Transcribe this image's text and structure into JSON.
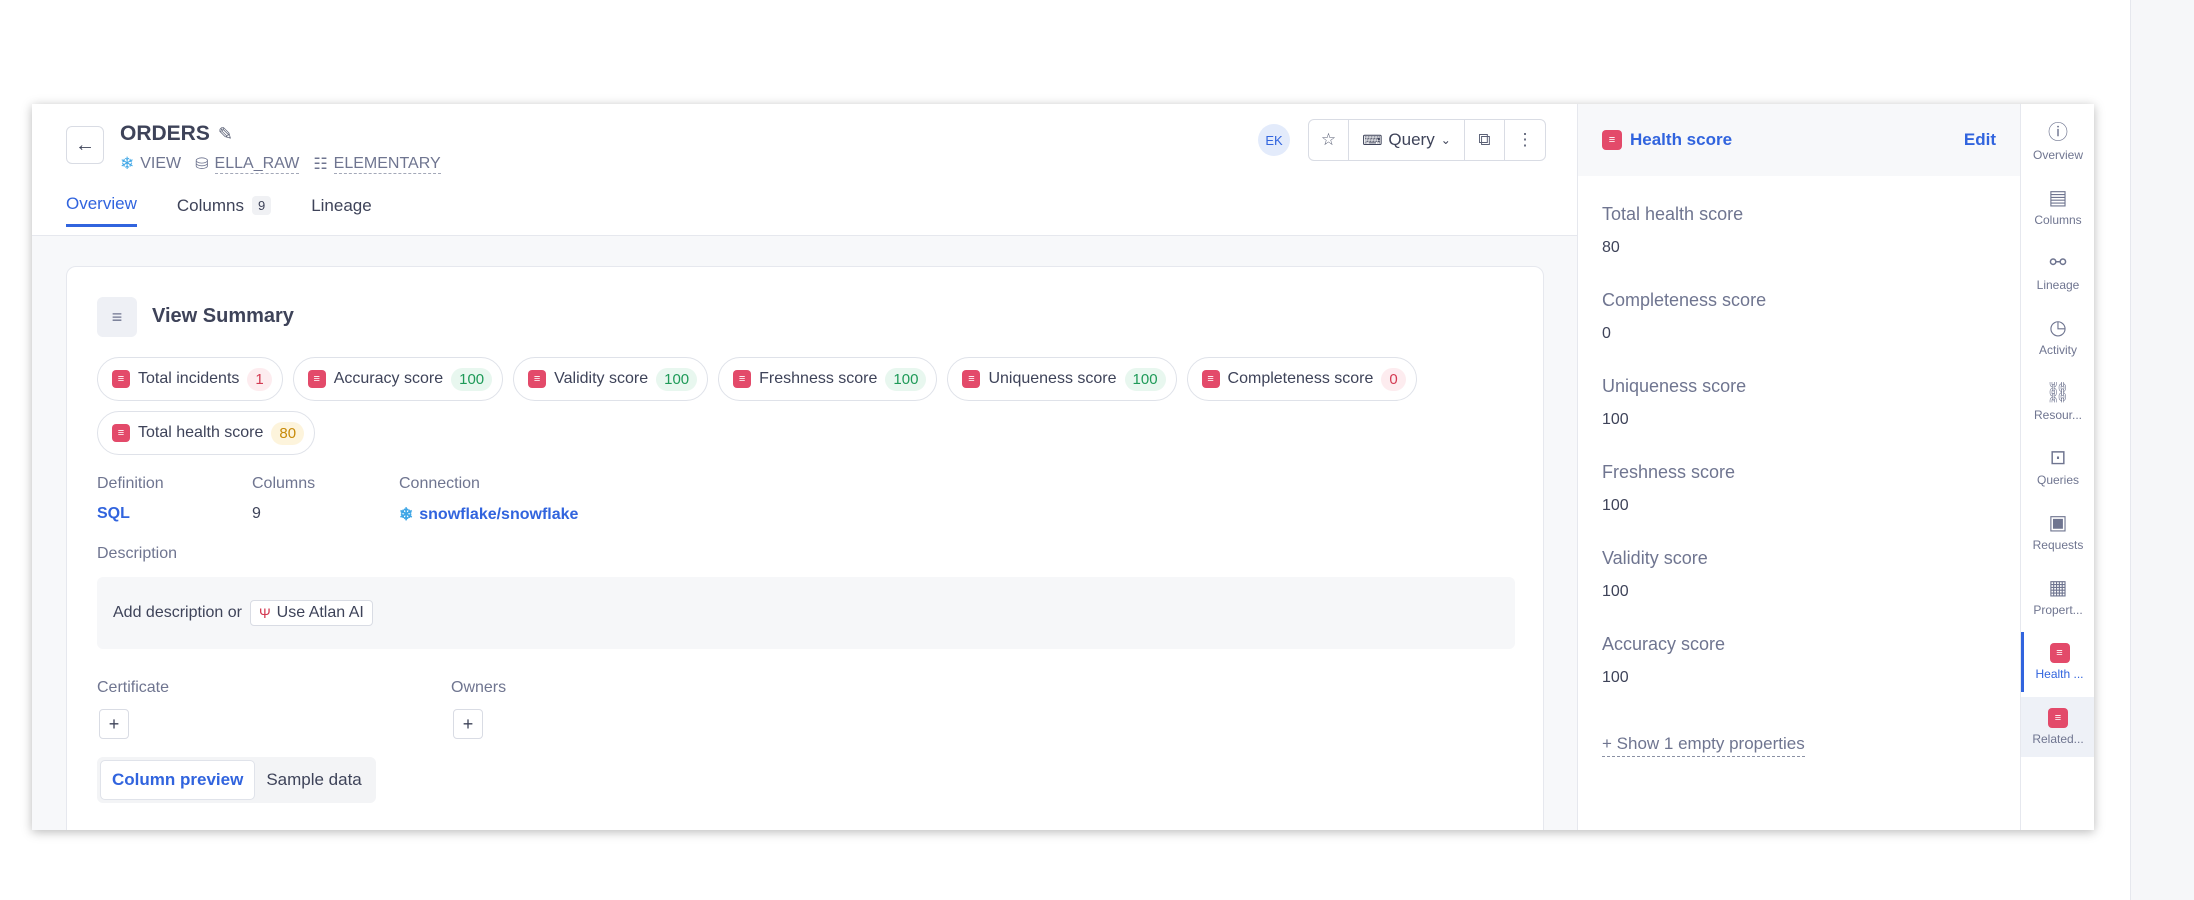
{
  "header": {
    "title": "ORDERS",
    "crumbs": {
      "type": "VIEW",
      "database": "ELLA_RAW",
      "schema": "ELEMENTARY"
    },
    "tabs": [
      {
        "label": "Overview"
      },
      {
        "label": "Columns",
        "count": "9"
      },
      {
        "label": "Lineage"
      }
    ],
    "avatar": "EK",
    "query_label": "Query"
  },
  "summary": {
    "title": "View Summary",
    "chips": [
      {
        "label": "Total incidents",
        "value": "1",
        "tone": "red"
      },
      {
        "label": "Accuracy score",
        "value": "100",
        "tone": "green"
      },
      {
        "label": "Validity score",
        "value": "100",
        "tone": "green"
      },
      {
        "label": "Freshness score",
        "value": "100",
        "tone": "green"
      },
      {
        "label": "Uniqueness score",
        "value": "100",
        "tone": "green"
      },
      {
        "label": "Completeness score",
        "value": "0",
        "tone": "red"
      },
      {
        "label": "Total health score",
        "value": "80",
        "tone": "yellow"
      }
    ],
    "definition_label": "Definition",
    "definition_value": "SQL",
    "columns_label": "Columns",
    "columns_value": "9",
    "connection_label": "Connection",
    "connection_value": "snowflake/snowflake",
    "description_label": "Description",
    "description_placeholder": "Add description or",
    "ai_button": "Use Atlan AI",
    "certificate_label": "Certificate",
    "owners_label": "Owners",
    "preview_tabs": [
      "Column preview",
      "Sample data"
    ]
  },
  "health_panel": {
    "title": "Health score",
    "edit": "Edit",
    "properties": [
      {
        "label": "Total health score",
        "value": "80"
      },
      {
        "label": "Completeness score",
        "value": "0"
      },
      {
        "label": "Uniqueness score",
        "value": "100"
      },
      {
        "label": "Freshness score",
        "value": "100"
      },
      {
        "label": "Validity score",
        "value": "100"
      },
      {
        "label": "Accuracy score",
        "value": "100"
      }
    ],
    "show_empty": "+ Show 1 empty properties"
  },
  "rail": [
    {
      "label": "Overview",
      "icon": "info-icon"
    },
    {
      "label": "Columns",
      "icon": "columns-icon"
    },
    {
      "label": "Lineage",
      "icon": "lineage-icon"
    },
    {
      "label": "Activity",
      "icon": "activity-icon"
    },
    {
      "label": "Resour...",
      "icon": "link-icon"
    },
    {
      "label": "Queries",
      "icon": "terminal-icon"
    },
    {
      "label": "Requests",
      "icon": "requests-icon"
    },
    {
      "label": "Propert...",
      "icon": "properties-icon"
    },
    {
      "label": "Health ...",
      "icon": "health-icon"
    },
    {
      "label": "Related...",
      "icon": "related-icon"
    }
  ],
  "colors": {
    "accent": "#3164de",
    "badge": "#e34a6a"
  }
}
